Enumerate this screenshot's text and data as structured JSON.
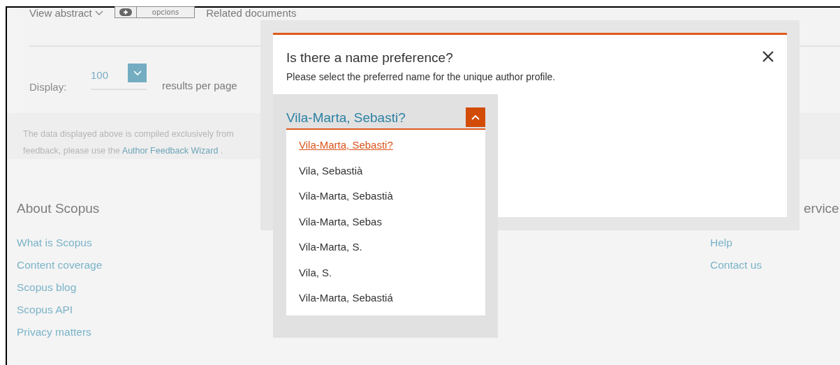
{
  "toolbar": {
    "view_abstract": "View abstract",
    "options_button": "opcions",
    "related": "Related documents"
  },
  "display": {
    "label": "Display:",
    "value": "100",
    "suffix": "results per page"
  },
  "note": {
    "line1": "The data displayed above is compiled exclusively from",
    "line2": "feedback, please use the",
    "link": "Author Feedback Wizard",
    "end": " ."
  },
  "footer": [
    {
      "heading": "About Scopus",
      "links": [
        "What is Scopus",
        "Content coverage",
        "Scopus blog",
        "Scopus API",
        "Privacy matters"
      ]
    },
    {
      "heading": "ervice",
      "links": [
        "Help",
        "Contact us"
      ]
    }
  ],
  "modal": {
    "title": "Is there a name preference?",
    "subtitle": "Please select the preferred name for the unique author profile.",
    "dropdown": {
      "value": "Vila-Marta, Sebasti?",
      "expanded": true,
      "options": [
        {
          "label": "Vila-Marta, Sebasti?",
          "selected": true
        },
        {
          "label": "Vila, Sebastià",
          "selected": false
        },
        {
          "label": "Vila-Marta, Sebastià",
          "selected": false
        },
        {
          "label": "Vila-Marta, Sebas",
          "selected": false
        },
        {
          "label": "Vila-Marta, S.",
          "selected": false
        },
        {
          "label": "Vila, S.",
          "selected": false
        },
        {
          "label": "Vila-Marta, Sebastiá",
          "selected": false
        }
      ]
    }
  }
}
